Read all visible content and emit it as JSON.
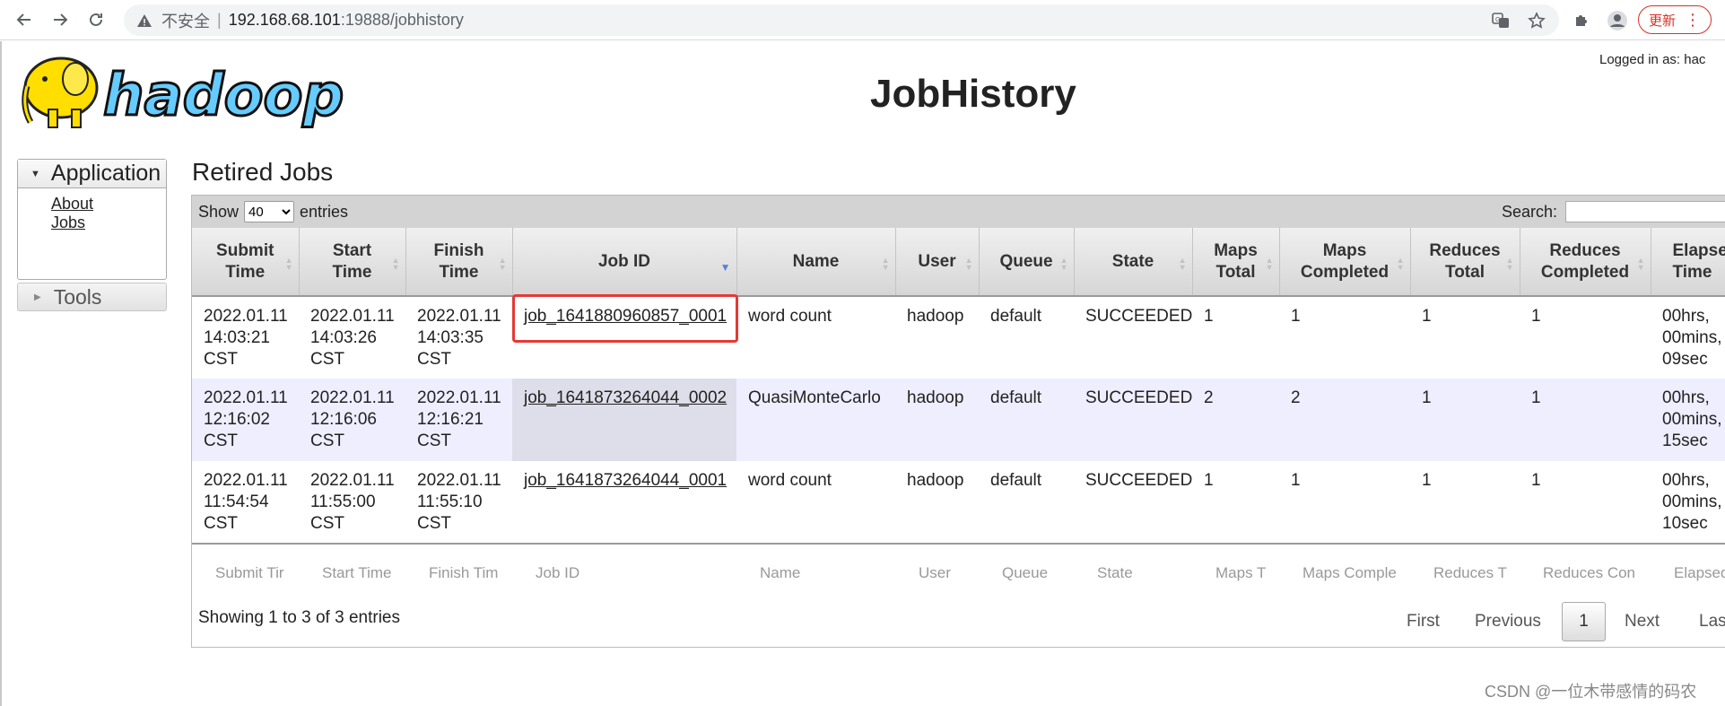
{
  "browser": {
    "insecure_label": "不安全",
    "url_host": "192.168.68.101",
    "url_path": ":19888/jobhistory",
    "update_label": "更新"
  },
  "header": {
    "title": "JobHistory",
    "logged_in": "Logged in as: hac",
    "logo_text": "hadoop"
  },
  "sidebar": {
    "application_label": "Application",
    "links": [
      "About",
      "Jobs"
    ],
    "tools_label": "Tools"
  },
  "main": {
    "section_title": "Retired Jobs",
    "show_label": "Show",
    "entries_label": "entries",
    "page_size": "40",
    "search_label": "Search:",
    "columns": [
      "Submit Time",
      "Start Time",
      "Finish Time",
      "Job ID",
      "Name",
      "User",
      "Queue",
      "State",
      "Maps Total",
      "Maps Completed",
      "Reduces Total",
      "Reduces Completed",
      "Elapsed Time"
    ],
    "footer_filters": [
      "Submit Tir",
      "Start Time",
      "Finish Tim",
      "Job ID",
      "Name",
      "User",
      "Queue",
      "State",
      "Maps T",
      "Maps Comple",
      "Reduces T",
      "Reduces Con",
      "Elapsed"
    ],
    "rows": [
      {
        "submit": [
          "2022.01.11",
          "14:03:21",
          "CST"
        ],
        "start": [
          "2022.01.11",
          "14:03:26",
          "CST"
        ],
        "finish": [
          "2022.01.11",
          "14:03:35",
          "CST"
        ],
        "job_id": "job_1641880960857_0001",
        "name": "word count",
        "user": "hadoop",
        "queue": "default",
        "state": "SUCCEEDED",
        "maps_total": "1",
        "maps_completed": "1",
        "reduces_total": "1",
        "reduces_completed": "1",
        "elapsed": [
          "00hrs,",
          "00mins,",
          "09sec"
        ]
      },
      {
        "submit": [
          "2022.01.11",
          "12:16:02",
          "CST"
        ],
        "start": [
          "2022.01.11",
          "12:16:06",
          "CST"
        ],
        "finish": [
          "2022.01.11",
          "12:16:21",
          "CST"
        ],
        "job_id": "job_1641873264044_0002",
        "name": "QuasiMonteCarlo",
        "user": "hadoop",
        "queue": "default",
        "state": "SUCCEEDED",
        "maps_total": "2",
        "maps_completed": "2",
        "reduces_total": "1",
        "reduces_completed": "1",
        "elapsed": [
          "00hrs,",
          "00mins,",
          "15sec"
        ]
      },
      {
        "submit": [
          "2022.01.11",
          "11:54:54",
          "CST"
        ],
        "start": [
          "2022.01.11",
          "11:55:00",
          "CST"
        ],
        "finish": [
          "2022.01.11",
          "11:55:10",
          "CST"
        ],
        "job_id": "job_1641873264044_0001",
        "name": "word count",
        "user": "hadoop",
        "queue": "default",
        "state": "SUCCEEDED",
        "maps_total": "1",
        "maps_completed": "1",
        "reduces_total": "1",
        "reduces_completed": "1",
        "elapsed": [
          "00hrs,",
          "00mins,",
          "10sec"
        ]
      }
    ],
    "showing": "Showing 1 to 3 of 3 entries",
    "pager": {
      "first": "First",
      "previous": "Previous",
      "current": "1",
      "next": "Next",
      "last": "Las"
    }
  },
  "watermark": "CSDN @一位木带感情的码农",
  "colors": {
    "highlight": "#e53935",
    "row_alt": "#eeeeff",
    "sort_active": "#5b82d8"
  }
}
